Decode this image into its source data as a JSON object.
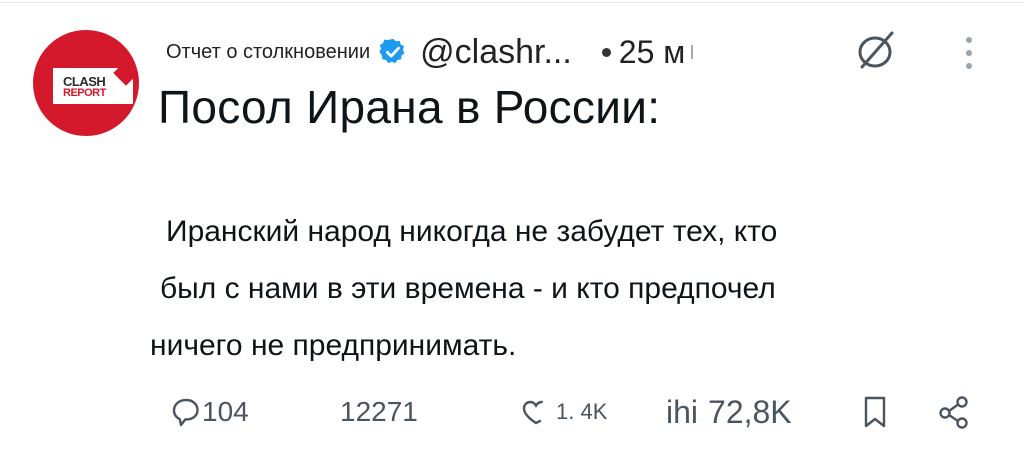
{
  "post": {
    "author_name": "Отчет о столкновении",
    "handle": "@clashr...",
    "time": "25 м",
    "avatar_logo": {
      "line1": "CLASH",
      "line2": "REPORT"
    },
    "title": "Посол Ирана в России:",
    "body_lines": [
      "Иранский народ никогда не забудет тех, кто",
      "был с нами в эти времена - и кто предпочел",
      "ничего не предпринимать."
    ]
  },
  "actions": {
    "replies": "104",
    "reposts": "12271",
    "likes": "1. 4K",
    "views_prefix": "ihi",
    "views": "72,8K"
  },
  "colors": {
    "avatar_red": "#d3192b",
    "verified_blue": "#1d9bf0",
    "text": "#0f1419",
    "icon_gray": "#4a5560"
  },
  "icons": [
    "verified-badge-icon",
    "grok-icon",
    "more-icon",
    "reply-icon",
    "like-icon",
    "bookmark-icon",
    "share-icon"
  ]
}
